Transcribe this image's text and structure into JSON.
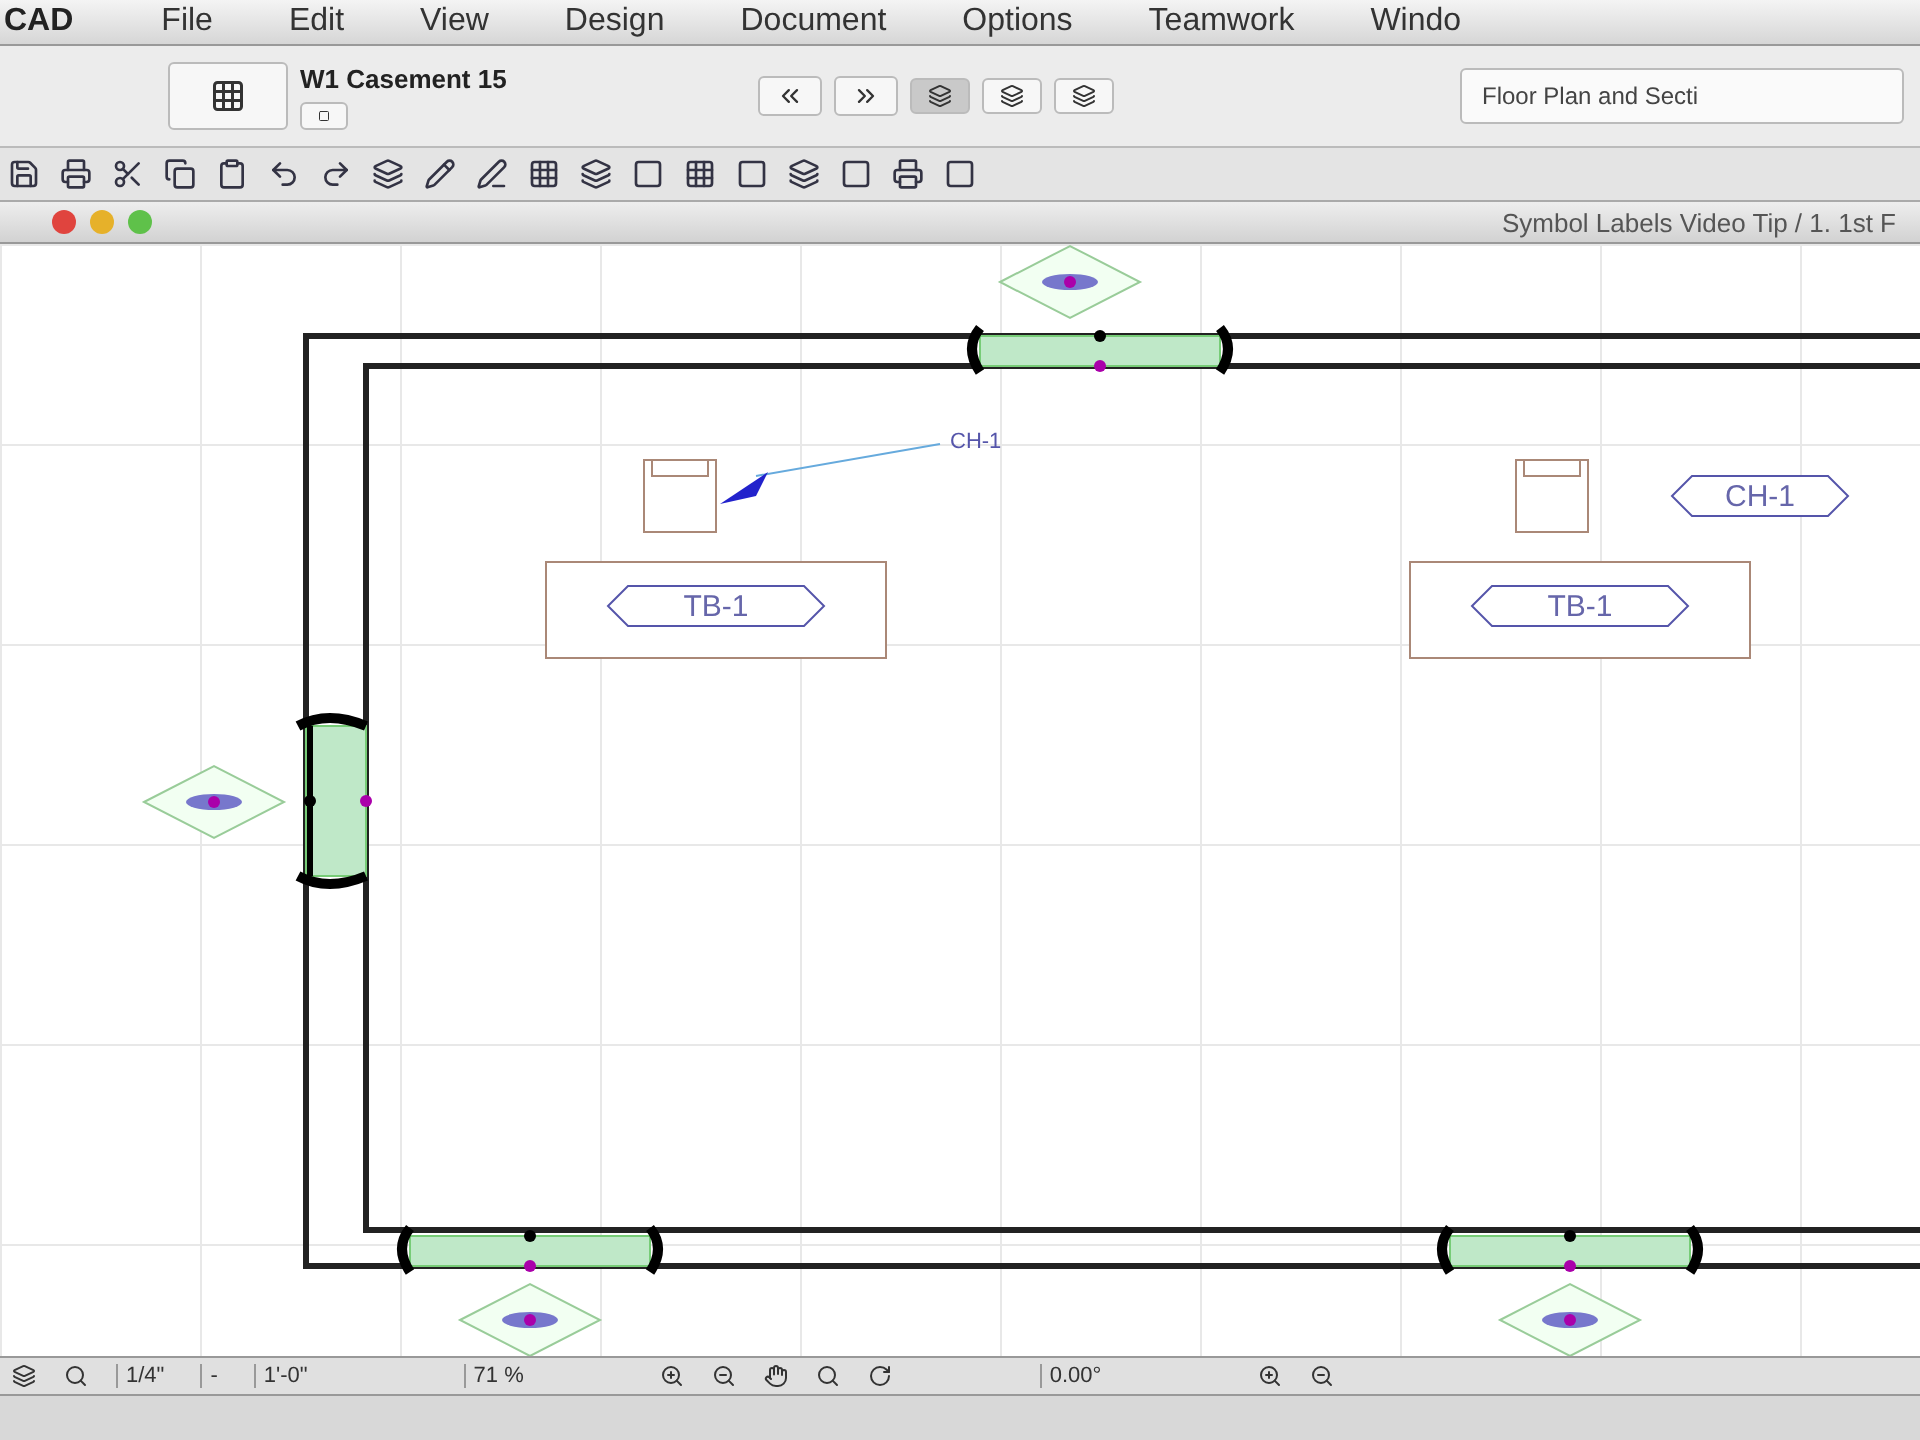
{
  "menu_bar": {
    "app": "CAD",
    "items": [
      "File",
      "Edit",
      "View",
      "Design",
      "Document",
      "Options",
      "Teamwork",
      "Windo"
    ]
  },
  "info_box": {
    "element": "W1 Casement 15",
    "view_combo": "Floor Plan and Secti"
  },
  "window": {
    "title": "Symbol Labels Video Tip / 1. 1st F"
  },
  "plan": {
    "chairs": [
      {
        "label": "CH-1"
      },
      {
        "label": "CH-1"
      }
    ],
    "tables": [
      {
        "label": "TB-1"
      },
      {
        "label": "TB-1"
      }
    ]
  },
  "status_bar": {
    "scale": "1/4\"",
    "separator": "-",
    "dimension": "1'-0\"",
    "zoom": "71 %",
    "angle": "0.00°"
  }
}
